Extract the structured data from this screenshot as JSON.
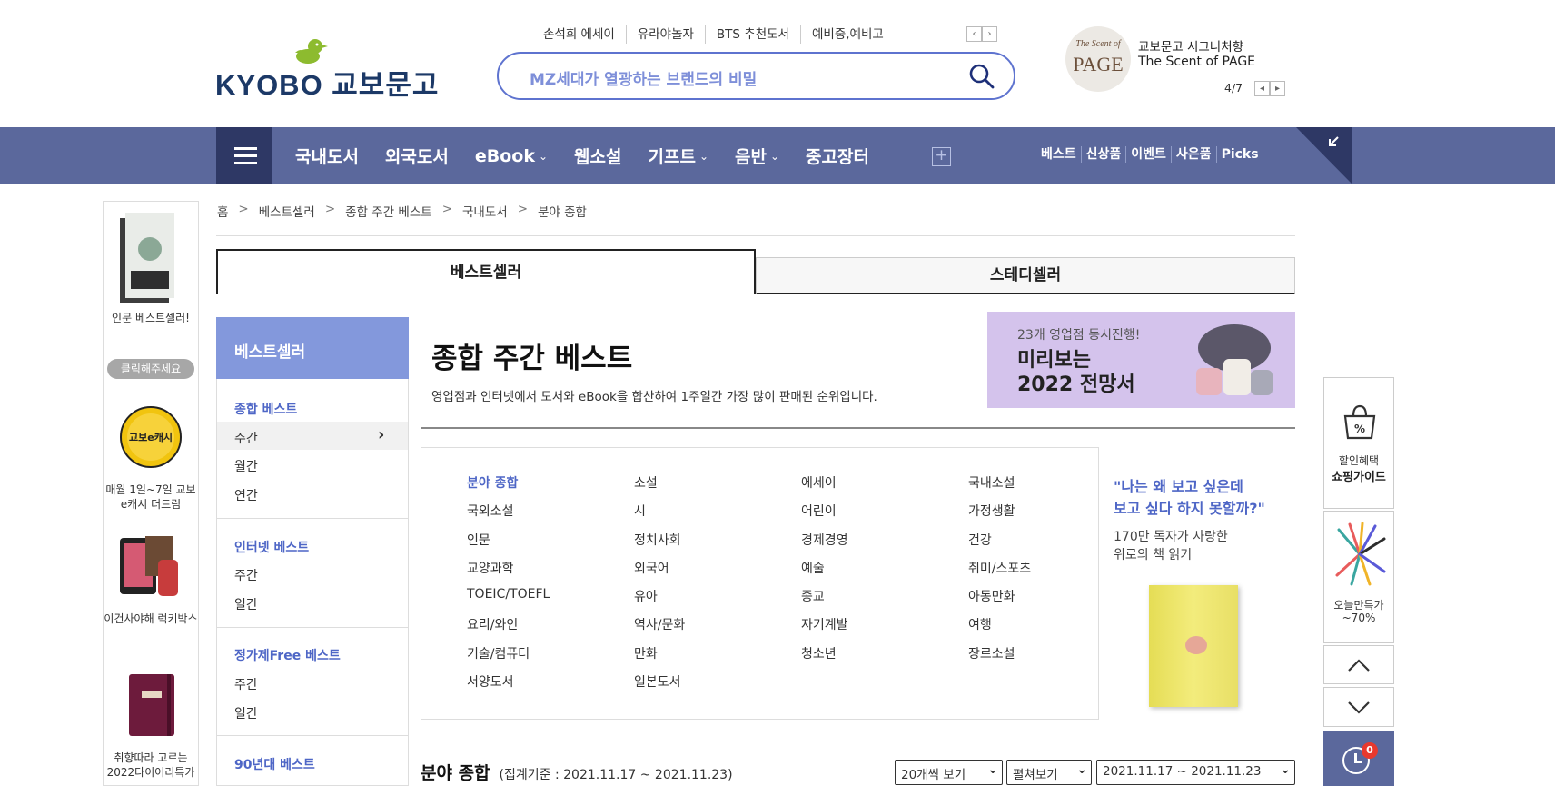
{
  "header": {
    "logo_text": "KYOBO 교보문고",
    "search_placeholder": "MZ세대가 열광하는 브랜드의 비밀",
    "hot_keywords": [
      "손석희 에세이",
      "유라야놀자",
      "BTS 추천도서",
      "예비중,예비고"
    ],
    "promo": {
      "circle_line1": "The Scent of",
      "circle_line2": "PAGE",
      "title": "교보문고 시그니처향",
      "subtitle": "The Scent of PAGE",
      "page_indicator": "4/7"
    }
  },
  "nav": {
    "items": [
      {
        "label": "국내도서",
        "chevron": ""
      },
      {
        "label": "외국도서",
        "chevron": ""
      },
      {
        "label": "eBook",
        "chevron": "⌄"
      },
      {
        "label": "웹소설",
        "chevron": ""
      },
      {
        "label": "기프트",
        "chevron": "⌄"
      },
      {
        "label": "음반",
        "chevron": "⌄"
      },
      {
        "label": "중고장터",
        "chevron": ""
      }
    ],
    "right_links": [
      "베스트",
      "신상품",
      "이벤트",
      "사은품",
      "Picks"
    ]
  },
  "left_rail": {
    "item1_label": "인문 베스트셀러!",
    "item1_button": "클릭해주세요",
    "item2_badge": "교보e캐시",
    "item2_label": "매월 1일~7일 교보e캐시 더드림",
    "item3_label": "이건사야해 럭키박스",
    "item4_label": "취향따라 고르는 2022다이어리특가"
  },
  "breadcrumb": [
    "홈",
    "베스트셀러",
    "종합 주간 베스트",
    "국내도서",
    "분야 종합"
  ],
  "tabs": {
    "best": "베스트셀러",
    "steady": "스테디셀러"
  },
  "sidebar": {
    "title": "베스트셀러",
    "groups": [
      {
        "label": "종합 베스트",
        "links": [
          "주간",
          "월간",
          "연간"
        ]
      },
      {
        "label": "인터넷 베스트",
        "links": [
          "주간",
          "일간"
        ]
      },
      {
        "label": "정가제Free 베스트",
        "links": [
          "주간",
          "일간"
        ]
      },
      {
        "label": "90년대 베스트",
        "links": []
      }
    ]
  },
  "main": {
    "title": "종합 주간 베스트",
    "description": "영업점과 인터넷에서 도서와 eBook을 합산하여 1주일간 가장 많이 판매된 순위입니다.",
    "banner": {
      "line1": "23개 영업점 동시진행!",
      "line2": "미리보는",
      "line3": "2022 전망서"
    },
    "categories": [
      "분야 종합",
      "소설",
      "에세이",
      "국내소설",
      "국외소설",
      "시",
      "어린이",
      "가정생활",
      "인문",
      "정치사회",
      "경제경영",
      "건강",
      "교양과학",
      "외국어",
      "예술",
      "취미/스포츠",
      "TOEIC/TOEFL",
      "유아",
      "종교",
      "아동만화",
      "요리/와인",
      "역사/문화",
      "자기계발",
      "여행",
      "기술/컴퓨터",
      "만화",
      "청소년",
      "장르소설",
      "서양도서",
      "일본도서"
    ],
    "category_ad": {
      "quote_line1": "\"나는 왜 보고 싶은데",
      "quote_line2": "보고 싶다 하지 못할까?\"",
      "sub_line1": "170만 독자가 사랑한",
      "sub_line2": "위로의 책 읽기"
    },
    "list_title": "분야 종합",
    "list_period": "(집계기준 : 2021.11.17 ~ 2021.11.23)",
    "select_count": "20개씩 보기",
    "select_view": "펼쳐보기",
    "select_period": "2021.11.17 ~ 2021.11.23"
  },
  "right_rail": {
    "shop_line1": "할인혜택",
    "shop_line2": "쇼핑가이드",
    "today_line1": "오늘만특가",
    "today_line2": "~70%",
    "recent_count": "0"
  },
  "colors": {
    "nav_bg": "#5b689c",
    "accent": "#4e66c6",
    "sidebar_head": "#8398dc",
    "banner_bg": "#d4c3ec"
  }
}
